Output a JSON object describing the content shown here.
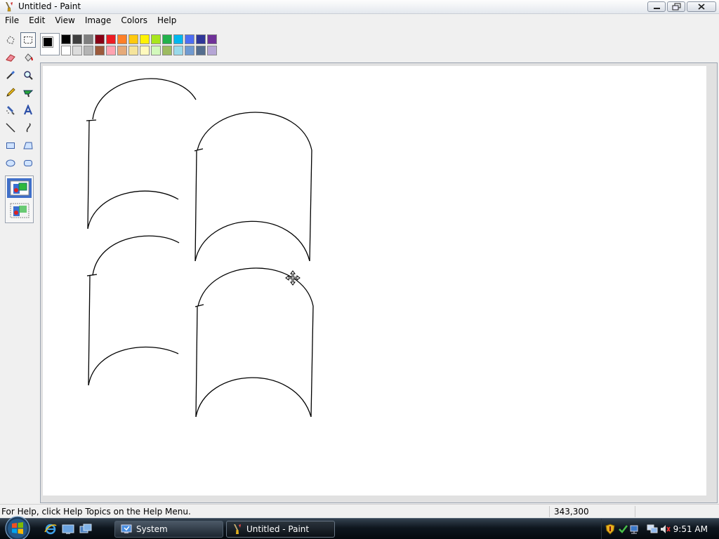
{
  "window": {
    "title": "Untitled - Paint",
    "icon": "paint-brush-icon",
    "controls": [
      "minimize-icon",
      "maximize-icon",
      "close-icon"
    ]
  },
  "menu": [
    "File",
    "Edit",
    "View",
    "Image",
    "Colors",
    "Help"
  ],
  "tools": [
    {
      "name": "free-form-select",
      "icon": "free-form-select-icon",
      "selected": false
    },
    {
      "name": "select",
      "icon": "rect-select-icon",
      "selected": true
    },
    {
      "name": "eraser",
      "icon": "eraser-icon",
      "selected": false
    },
    {
      "name": "fill-with-color",
      "icon": "paint-bucket-icon",
      "selected": false
    },
    {
      "name": "pick-color",
      "icon": "eyedropper-icon",
      "selected": false
    },
    {
      "name": "magnifier",
      "icon": "magnifier-icon",
      "selected": false
    },
    {
      "name": "pencil",
      "icon": "pencil-icon",
      "selected": false
    },
    {
      "name": "brush",
      "icon": "brush-icon",
      "selected": false
    },
    {
      "name": "airbrush",
      "icon": "airbrush-icon",
      "selected": false
    },
    {
      "name": "text",
      "icon": "text-icon",
      "selected": false
    },
    {
      "name": "line",
      "icon": "line-icon",
      "selected": false
    },
    {
      "name": "curve",
      "icon": "curve-icon",
      "selected": false
    },
    {
      "name": "rectangle",
      "icon": "rectangle-icon",
      "selected": false
    },
    {
      "name": "polygon",
      "icon": "polygon-icon",
      "selected": false
    },
    {
      "name": "ellipse",
      "icon": "ellipse-icon",
      "selected": false
    },
    {
      "name": "rounded-rectangle",
      "icon": "rounded-rectangle-icon",
      "selected": false
    }
  ],
  "tool_options": [
    {
      "name": "opaque-selection",
      "icon": "opaque-selection-icon",
      "selected": true
    },
    {
      "name": "transparent-selection",
      "icon": "transparent-selection-icon",
      "selected": false
    }
  ],
  "colors": {
    "foreground": "#000000",
    "background": "#ffffff",
    "palette_top": [
      "#000000",
      "#3f3f3f",
      "#7f7f7f",
      "#880015",
      "#ed1c24",
      "#ff7f27",
      "#ffc90e",
      "#fff200",
      "#a8e61d",
      "#22b14c",
      "#00b7ef",
      "#4d6df3",
      "#2f3699",
      "#6f3198"
    ],
    "palette_bottom": [
      "#ffffff",
      "#dcdcdc",
      "#b4b4b4",
      "#9c5a3c",
      "#ffa3b1",
      "#e5aa7a",
      "#f5e49c",
      "#fff9bd",
      "#d3f9bc",
      "#9dbb61",
      "#99d9ea",
      "#709ad1",
      "#546d8e",
      "#b5a5d5"
    ]
  },
  "status": {
    "help_text": "For Help, click Help Topics on the Help Menu.",
    "coordinates": "343,300"
  },
  "taskbar": {
    "start_icon": "windows-start-orb-icon",
    "quick_launch": [
      "internet-explorer-icon",
      "show-desktop-icon",
      "switch-windows-icon"
    ],
    "buttons": [
      {
        "label": "System",
        "icon": "system-icon",
        "active": false
      },
      {
        "label": "Untitled - Paint",
        "icon": "paint-brush-icon",
        "active": true
      }
    ],
    "tray_icons": [
      "shield-icon",
      "security-check-icon",
      "network-icon",
      "monitor-icon",
      "volume-muted-icon"
    ],
    "clock": "9:51 AM"
  }
}
